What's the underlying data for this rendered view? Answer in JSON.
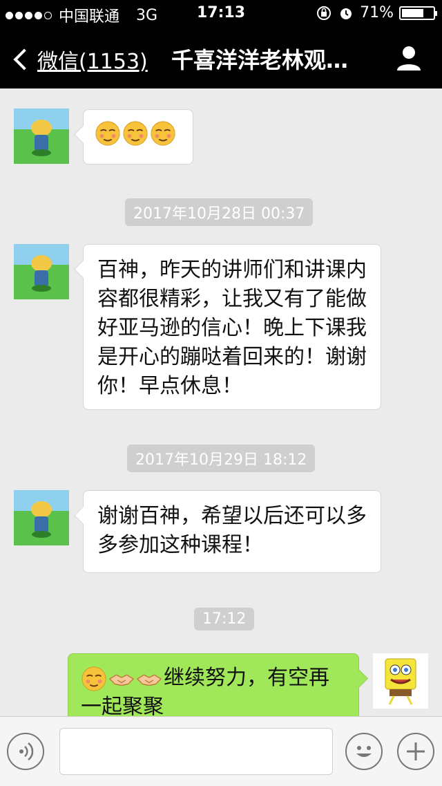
{
  "status_bar": {
    "carrier": "中国联通",
    "network": "3G",
    "time": "17:13",
    "battery": "71%",
    "battery_level": 0.71
  },
  "nav": {
    "back_label": "微信(1153)",
    "title": "千喜洋洋老林观…"
  },
  "messages": [
    {
      "text": ""
    },
    {
      "text": "百神，昨天的讲师们和讲课内容都很精彩，让我又有了能做好亚马逊的信心！晚上下课我是开心的蹦哒着回来的！谢谢你！早点休息！"
    },
    {
      "text": "谢谢百神，希望以后还可以多多参加这种课程！"
    },
    {
      "text": "继续努力，有空再一起聚聚"
    }
  ],
  "timestamps": [
    "2017年10月28日 00:37",
    "2017年10月29日 18:12",
    "17:12"
  ],
  "colors": {
    "bubble_green": "#a0e75a",
    "background": "#ebebeb",
    "header": "#000000"
  }
}
